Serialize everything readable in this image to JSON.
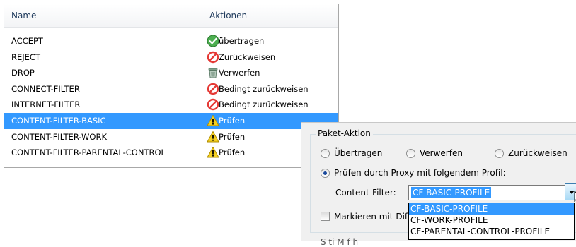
{
  "list": {
    "header": {
      "name": "Name",
      "actions": "Aktionen"
    },
    "rows": [
      {
        "name": "ACCEPT",
        "action": "übertragen",
        "icon": "check-icon"
      },
      {
        "name": "REJECT",
        "action": "Zurückweisen",
        "icon": "prohibited-icon"
      },
      {
        "name": "DROP",
        "action": "Verwerfen",
        "icon": "trash-icon"
      },
      {
        "name": "CONNECT-FILTER",
        "action": "Bedingt zurückweisen",
        "icon": "prohibited-icon"
      },
      {
        "name": "INTERNET-FILTER",
        "action": "Bedingt zurückweisen",
        "icon": "prohibited-icon"
      },
      {
        "name": "CONTENT-FILTER-BASIC",
        "action": "Prüfen",
        "icon": "warning-icon",
        "selected": true
      },
      {
        "name": "CONTENT-FILTER-WORK",
        "action": "Prüfen",
        "icon": "warning-icon"
      },
      {
        "name": "CONTENT-FILTER-PARENTAL-CONTROL",
        "action": "Prüfen",
        "icon": "warning-icon"
      }
    ]
  },
  "paket": {
    "title": "Paket-Aktion",
    "radio_transfer": "Übertragen",
    "radio_drop": "Verwerfen",
    "radio_reject": "Zurückweisen",
    "radio_proxy": "Prüfen durch Proxy mit folgendem Profil:",
    "content_filter_label": "Content-Filter:",
    "content_filter_value": "CF-BASIC-PROFILE",
    "options": [
      "CF-BASIC-PROFILE",
      "CF-WORK-PROFILE",
      "CF-PARENTAL-CONTROL-PROFILE"
    ],
    "mark_label": "Markieren mit Dif",
    "bottom_label": "S     ti   M   f  h"
  },
  "colors": {
    "selection": "#3399ff",
    "check": "#4caf50",
    "prohibited": "#e53935",
    "warning": "#f5d020"
  }
}
